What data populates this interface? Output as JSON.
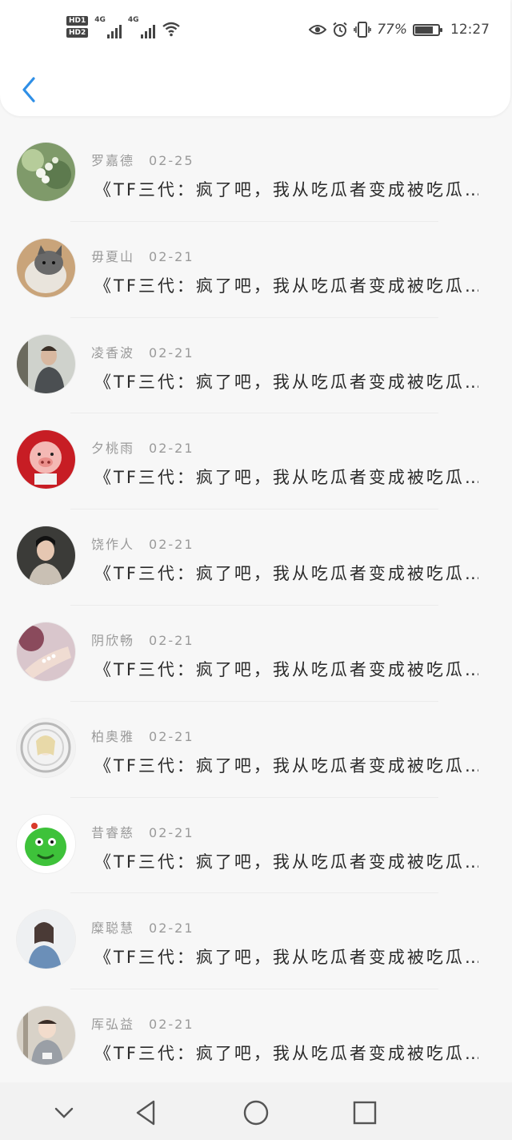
{
  "status_bar": {
    "hd1": "HD1",
    "hd2": "HD2",
    "net1": "4G",
    "net2": "4G",
    "battery_pct": "77%",
    "battery_level": 0.77,
    "time": "12:27",
    "icons": [
      "eye-icon",
      "alarm-icon",
      "vibrate-icon",
      "battery-icon",
      "wifi-icon"
    ]
  },
  "header": {
    "back_icon": "back-chevron-icon",
    "accent": "#2f8fe6"
  },
  "items": [
    {
      "name": "罗嘉德",
      "date": "02-25",
      "message": "《TF三代：疯了吧，我从吃瓜者变成被吃瓜…",
      "avatar": "flowers"
    },
    {
      "name": "毋夏山",
      "date": "02-21",
      "message": "《TF三代：疯了吧，我从吃瓜者变成被吃瓜…",
      "avatar": "cat"
    },
    {
      "name": "凌香波",
      "date": "02-21",
      "message": "《TF三代：疯了吧，我从吃瓜者变成被吃瓜…",
      "avatar": "man"
    },
    {
      "name": "夕桃雨",
      "date": "02-21",
      "message": "《TF三代：疯了吧，我从吃瓜者变成被吃瓜…",
      "avatar": "pig"
    },
    {
      "name": "饶作人",
      "date": "02-21",
      "message": "《TF三代：疯了吧，我从吃瓜者变成被吃瓜…",
      "avatar": "boy"
    },
    {
      "name": "阴欣畅",
      "date": "02-21",
      "message": "《TF三代：疯了吧，我从吃瓜者变成被吃瓜…",
      "avatar": "hand"
    },
    {
      "name": "柏奥雅",
      "date": "02-21",
      "message": "《TF三代：疯了吧，我从吃瓜者变成被吃瓜…",
      "avatar": "anime"
    },
    {
      "name": "昔睿慈",
      "date": "02-21",
      "message": "《TF三代：疯了吧，我从吃瓜者变成被吃瓜…",
      "avatar": "green"
    },
    {
      "name": "糜聪慧",
      "date": "02-21",
      "message": "《TF三代：疯了吧，我从吃瓜者变成被吃瓜…",
      "avatar": "girl"
    },
    {
      "name": "厍弘益",
      "date": "02-21",
      "message": "《TF三代：疯了吧，我从吃瓜者变成被吃瓜…",
      "avatar": "child"
    }
  ],
  "nav_bar": {
    "buttons": [
      "nav-down-icon",
      "nav-back-icon",
      "nav-home-icon",
      "nav-recents-icon"
    ]
  }
}
